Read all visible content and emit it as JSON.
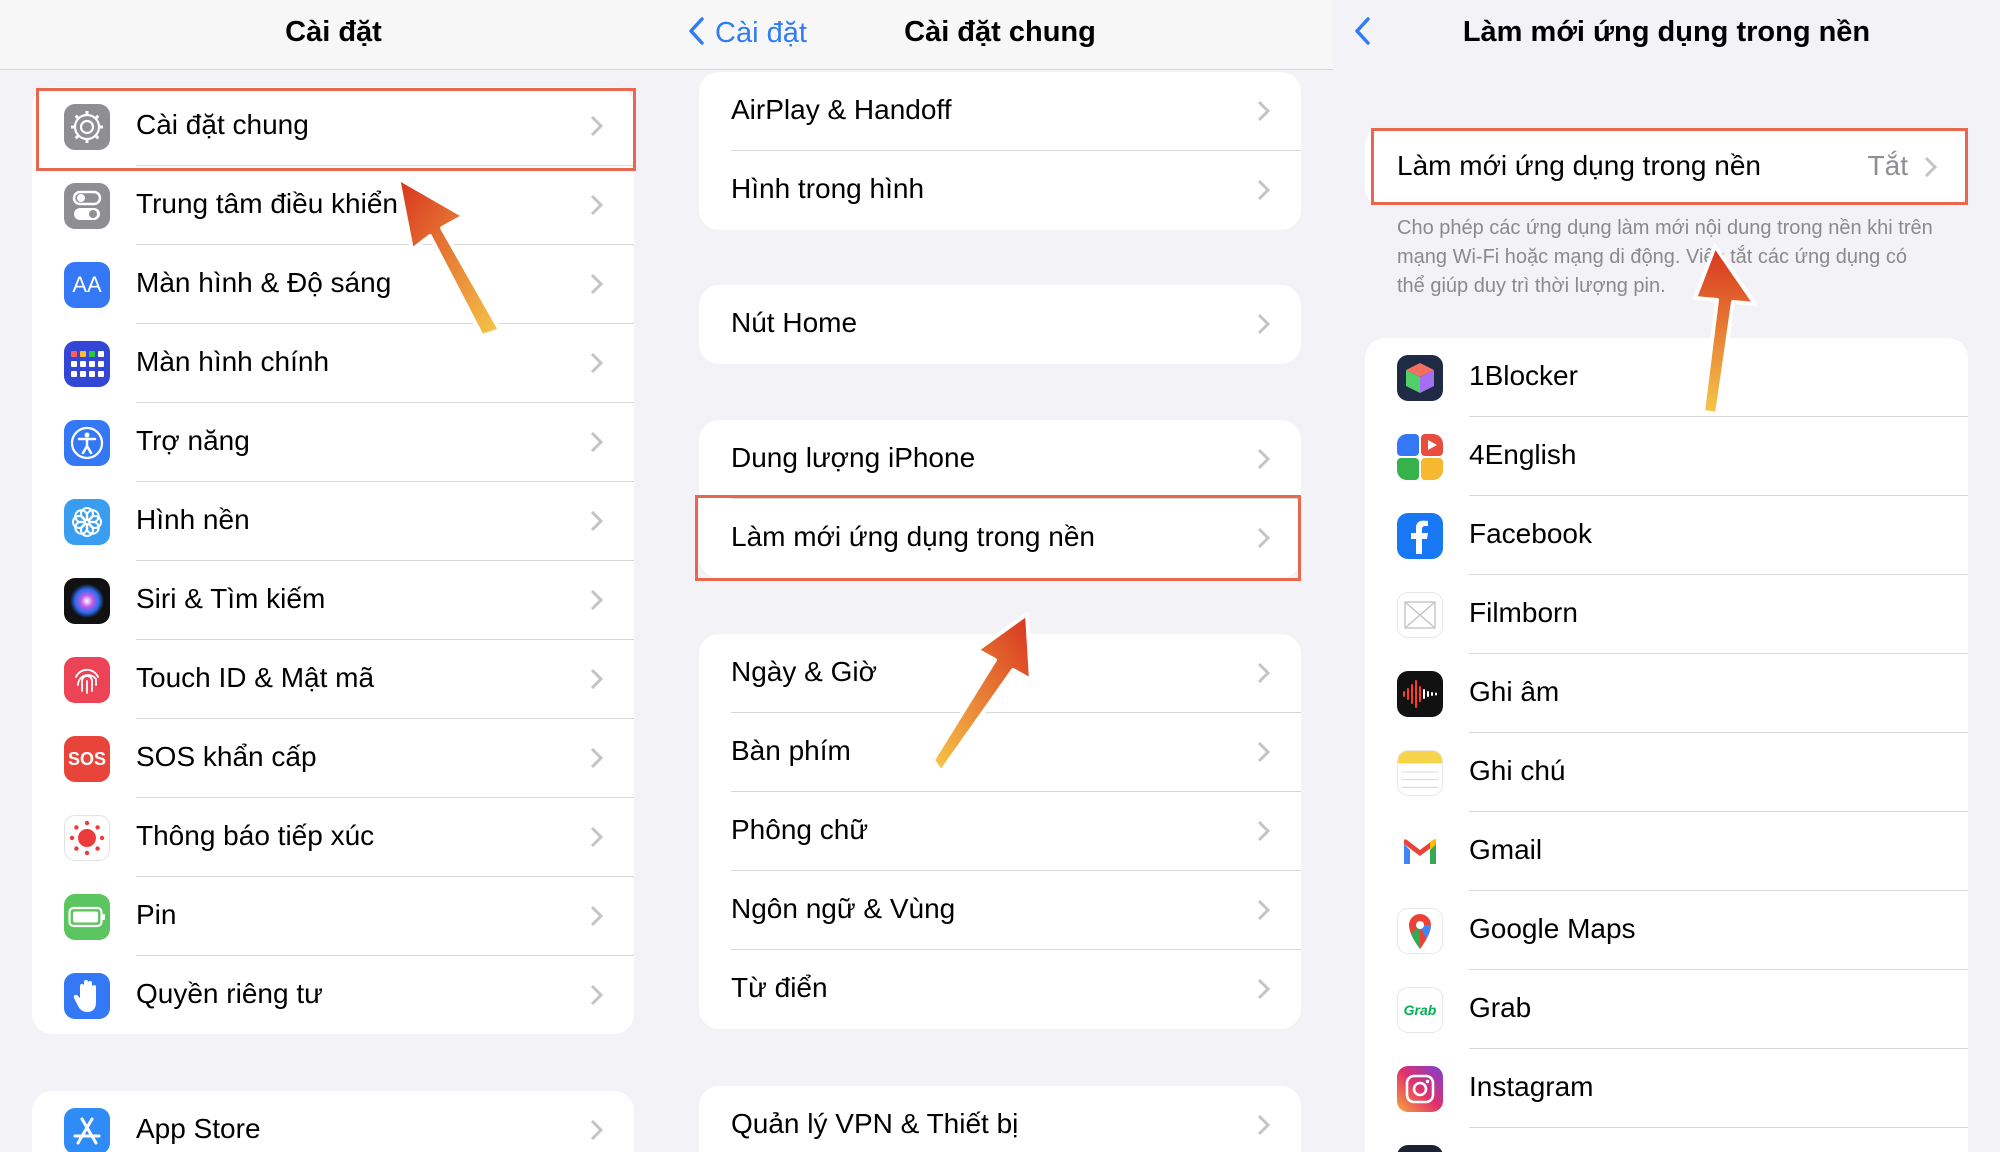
{
  "panel1": {
    "title": "Cài đặt",
    "rows": [
      {
        "label": "Cài đặt chung",
        "icon": "gear-icon"
      },
      {
        "label": "Trung tâm điều khiển",
        "icon": "toggles-icon"
      },
      {
        "label": "Màn hình & Độ sáng",
        "icon": "text-size-icon",
        "icon_text": "AA"
      },
      {
        "label": "Màn hình chính",
        "icon": "app-grid-icon"
      },
      {
        "label": "Trợ năng",
        "icon": "accessibility-icon"
      },
      {
        "label": "Hình nền",
        "icon": "flower-icon"
      },
      {
        "label": "Siri & Tìm kiếm",
        "icon": "siri-icon"
      },
      {
        "label": "Touch ID & Mật mã",
        "icon": "fingerprint-icon"
      },
      {
        "label": "SOS khẩn cấp",
        "icon": "sos-icon",
        "icon_text": "SOS"
      },
      {
        "label": "Thông báo tiếp xúc",
        "icon": "exposure-icon"
      },
      {
        "label": "Pin",
        "icon": "battery-icon"
      },
      {
        "label": "Quyền riêng tư",
        "icon": "hand-icon"
      }
    ],
    "app_store": {
      "label": "App Store",
      "icon": "app-store-icon"
    }
  },
  "panel2": {
    "back_label": "Cài đặt",
    "title": "Cài đặt chung",
    "group1": [
      "AirPlay & Handoff",
      "Hình trong hình"
    ],
    "group2": [
      "Nút Home"
    ],
    "group3": [
      "Dung lượng iPhone",
      "Làm mới ứng dụng trong nền"
    ],
    "group4": [
      "Ngày & Giờ",
      "Bàn phím",
      "Phông chữ",
      "Ngôn ngữ & Vùng",
      "Từ điển"
    ],
    "group5": [
      "Quản lý VPN & Thiết bị"
    ]
  },
  "panel3": {
    "title": "Làm mới ứng dụng trong nền",
    "setting_label": "Làm mới ứng dụng trong nền",
    "setting_value": "Tắt",
    "footer": "Cho phép các ứng dụng làm mới nội dung trong nền khi trên mạng Wi-Fi hoặc mạng di động. Việc tắt các ứng dụng có thể giúp duy trì thời lượng pin.",
    "apps": [
      "1Blocker",
      "4English",
      "Facebook",
      "Filmborn",
      "Ghi âm",
      "Ghi chú",
      "Gmail",
      "Google Maps",
      "Grab",
      "Instagram"
    ]
  },
  "colors": {
    "accent": "#2f7cf6",
    "highlight": "#e8684f",
    "arrow_top": "#d8331f",
    "arrow_bottom": "#f6c84a"
  }
}
